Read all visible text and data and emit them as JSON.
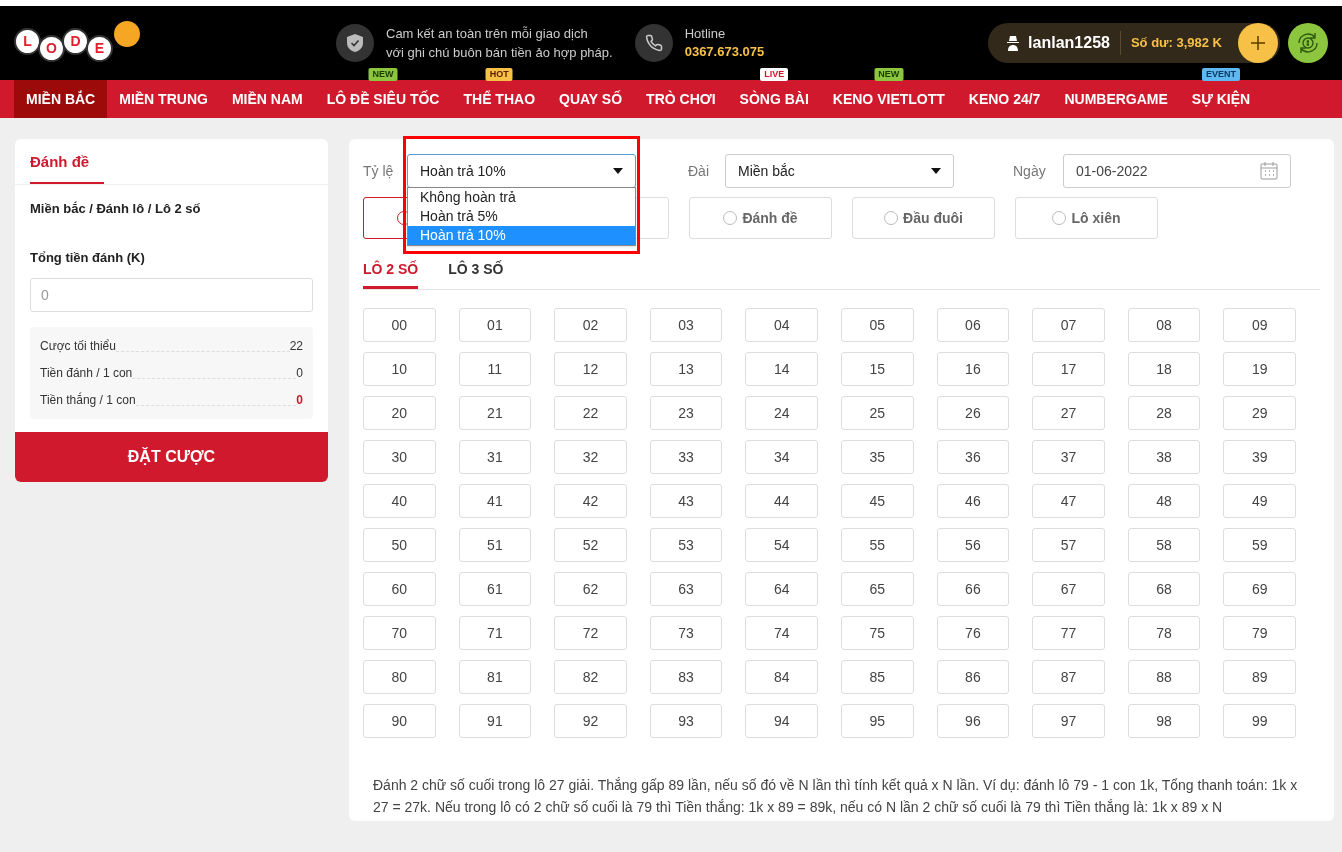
{
  "header": {
    "logo": {
      "letters": [
        "L",
        "O",
        "D",
        "E"
      ]
    },
    "promise": {
      "line1": "Cam kết an toàn trên mỗi giao dịch",
      "line2": "với ghi chú buôn bán tiền ảo hợp pháp."
    },
    "hotline": {
      "label": "Hotline",
      "number": "0367.673.075"
    },
    "account": {
      "username": "lanlan1258",
      "balance": "Số dư: 3,982 K"
    }
  },
  "nav": [
    {
      "label": "MIỀN BẮC",
      "selected": true
    },
    {
      "label": "MIỀN TRUNG",
      "selected": false
    },
    {
      "label": "MIỀN NAM",
      "selected": false
    },
    {
      "label": "LÔ ĐỀ SIÊU TỐC",
      "selected": false,
      "badge": "NEW",
      "kind": "new"
    },
    {
      "label": "THỂ THAO",
      "selected": false,
      "badge": "HOT",
      "kind": "hot"
    },
    {
      "label": "QUAY SỐ",
      "selected": false
    },
    {
      "label": "TRÒ CHƠI",
      "selected": false
    },
    {
      "label": "SÒNG BÀI",
      "selected": false,
      "badge": "LIVE",
      "kind": "live"
    },
    {
      "label": "KENO VIETLOTT",
      "selected": false,
      "badge": "NEW",
      "kind": "new"
    },
    {
      "label": "KENO 24/7",
      "selected": false
    },
    {
      "label": "NUMBERGAME",
      "selected": false
    },
    {
      "label": "SỰ KIỆN",
      "selected": false,
      "badge": "EVENT",
      "kind": "event"
    }
  ],
  "bet_panel": {
    "title": "Đánh đề",
    "breadcrumb": "Miền bắc / Đánh lô / Lô 2 số",
    "amount_label": "Tổng tiền đánh (K)",
    "amount_placeholder": "0",
    "summary": [
      {
        "label": "Cược tối thiểu",
        "value": "22",
        "emphasis": false
      },
      {
        "label": "Tiền đánh / 1 con",
        "value": "0",
        "emphasis": false
      },
      {
        "label": "Tiền thắng / 1 con",
        "value": "0",
        "emphasis": true
      }
    ],
    "submit": "ĐẶT CƯỢC"
  },
  "filters": {
    "rate": {
      "label": "Tỷ lệ",
      "value": "Hoàn trả 10%",
      "expanded": true,
      "options": [
        {
          "label": "Không hoàn trả",
          "selected": false
        },
        {
          "label": "Hoàn trả 5%",
          "selected": false
        },
        {
          "label": "Hoàn trả 10%",
          "selected": true
        }
      ]
    },
    "station": {
      "label": "Đài",
      "value": "Miền bắc"
    },
    "date": {
      "label": "Ngày",
      "value": "01-06-2022"
    }
  },
  "bet_types_covered": [
    {
      "selected": true
    },
    {
      "selected": false
    }
  ],
  "bet_types": [
    {
      "label": "Đánh đề",
      "selected": false
    },
    {
      "label": "Đầu đuôi",
      "selected": false
    },
    {
      "label": "Lô xiên",
      "selected": false
    }
  ],
  "tabs": [
    {
      "label": "LÔ 2 SỐ",
      "selected": true
    },
    {
      "label": "LÔ 3 SỐ",
      "selected": false
    }
  ],
  "numbers": [
    "00",
    "01",
    "02",
    "03",
    "04",
    "05",
    "06",
    "07",
    "08",
    "09",
    "10",
    "11",
    "12",
    "13",
    "14",
    "15",
    "16",
    "17",
    "18",
    "19",
    "20",
    "21",
    "22",
    "23",
    "24",
    "25",
    "26",
    "27",
    "28",
    "29",
    "30",
    "31",
    "32",
    "33",
    "34",
    "35",
    "36",
    "37",
    "38",
    "39",
    "40",
    "41",
    "42",
    "43",
    "44",
    "45",
    "46",
    "47",
    "48",
    "49",
    "50",
    "51",
    "52",
    "53",
    "54",
    "55",
    "56",
    "57",
    "58",
    "59",
    "60",
    "61",
    "62",
    "63",
    "64",
    "65",
    "66",
    "67",
    "68",
    "69",
    "70",
    "71",
    "72",
    "73",
    "74",
    "75",
    "76",
    "77",
    "78",
    "79",
    "80",
    "81",
    "82",
    "83",
    "84",
    "85",
    "86",
    "87",
    "88",
    "89",
    "90",
    "91",
    "92",
    "93",
    "94",
    "95",
    "96",
    "97",
    "98",
    "99"
  ],
  "description": "Đánh 2 chữ số cuối trong lô 27 giải. Thắng gấp 89 lần, nếu số đó về N lần thì tính kết quả x N lần. Ví dụ: đánh lô 79 - 1 con 1k, Tổng thanh toán: 1k x 27 = 27k. Nếu trong lô có 2 chữ số cuối là 79 thì Tiền thắng: 1k x 89 = 89k, nếu có N lần 2 chữ số cuối là 79 thì Tiền thắng là: 1k x 89 x N"
}
